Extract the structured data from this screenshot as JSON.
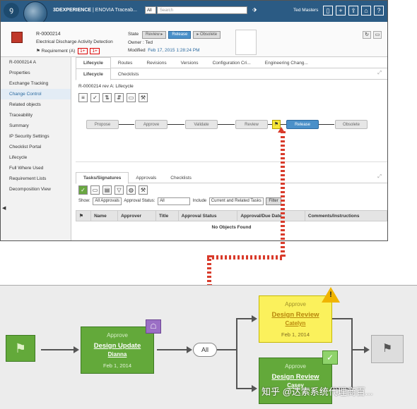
{
  "app": {
    "brand_strong": "3DEXPERIENCE",
    "brand_rest": " | ENOVIA Traceab...",
    "all_label": "All",
    "search_placeholder": "Search",
    "user_name": "Ted Masters"
  },
  "object": {
    "name": "R-0000214",
    "description": "Electrical Discharge Activity Detection",
    "type_label": "Requirement (A)",
    "badge1": "1+",
    "badge2": "1+",
    "state_label": "State",
    "state_buttons": [
      "Review ▸",
      "Release",
      "▸ Obsolete"
    ],
    "owner_label": "Owner",
    "owner_value": "Ted",
    "modified_label": "Modified",
    "modified_value": "Feb 17, 2015 1:28:24 PM"
  },
  "sidebar": {
    "items": [
      "R-0000214 A",
      "Properties",
      "Exchange Tracking",
      "Change Control",
      "Related objects",
      "Traceability",
      "Summary",
      "IP Security Settings",
      "Checklist Portal",
      "Lifecycle",
      "Full Where Used",
      "Requirement Lists",
      "Decomposition View"
    ]
  },
  "main": {
    "tabs": [
      "Lifecycle",
      "Routes",
      "Revisions",
      "Versions",
      "Configuration Cri...",
      "Engineering Chang..."
    ],
    "subtabs": [
      "Lifecycle",
      "Checklists"
    ],
    "path": "R-0000214 rev A: Lifecycle",
    "states": [
      "Propose",
      "Approve",
      "Validate",
      "Review",
      "Release",
      "Obsolete"
    ],
    "lower_tabs": [
      "Tasks/Signatures",
      "Approvals",
      "Checklists"
    ],
    "filter": {
      "show_label": "Show",
      "show_value": "All Approvals",
      "approval_status_label": "Approval Status",
      "approval_status_value": "All",
      "include_label": "Include",
      "include_value": "Current and Related Tasks",
      "filter_button": "Filter"
    },
    "table_headers": [
      "",
      "Name",
      "Approver",
      "Title",
      "Approval Status",
      "Approval/Due Date",
      "Comments/Instructions"
    ],
    "empty_message": "No Objects Found"
  },
  "diagram": {
    "node1": {
      "sub": "Approve",
      "title": "Design Update",
      "who": "Dianna",
      "date": "Feb 1, 2014"
    },
    "all_label": "All",
    "node2": {
      "sub": "Approve",
      "title": "Design Review",
      "who": "Catelyn",
      "date": "Feb 1, 2014"
    },
    "node3": {
      "sub": "Approve",
      "title": "Design Review",
      "who": "Casey"
    },
    "watermark": "知乎 @达索系统代理商百..."
  }
}
